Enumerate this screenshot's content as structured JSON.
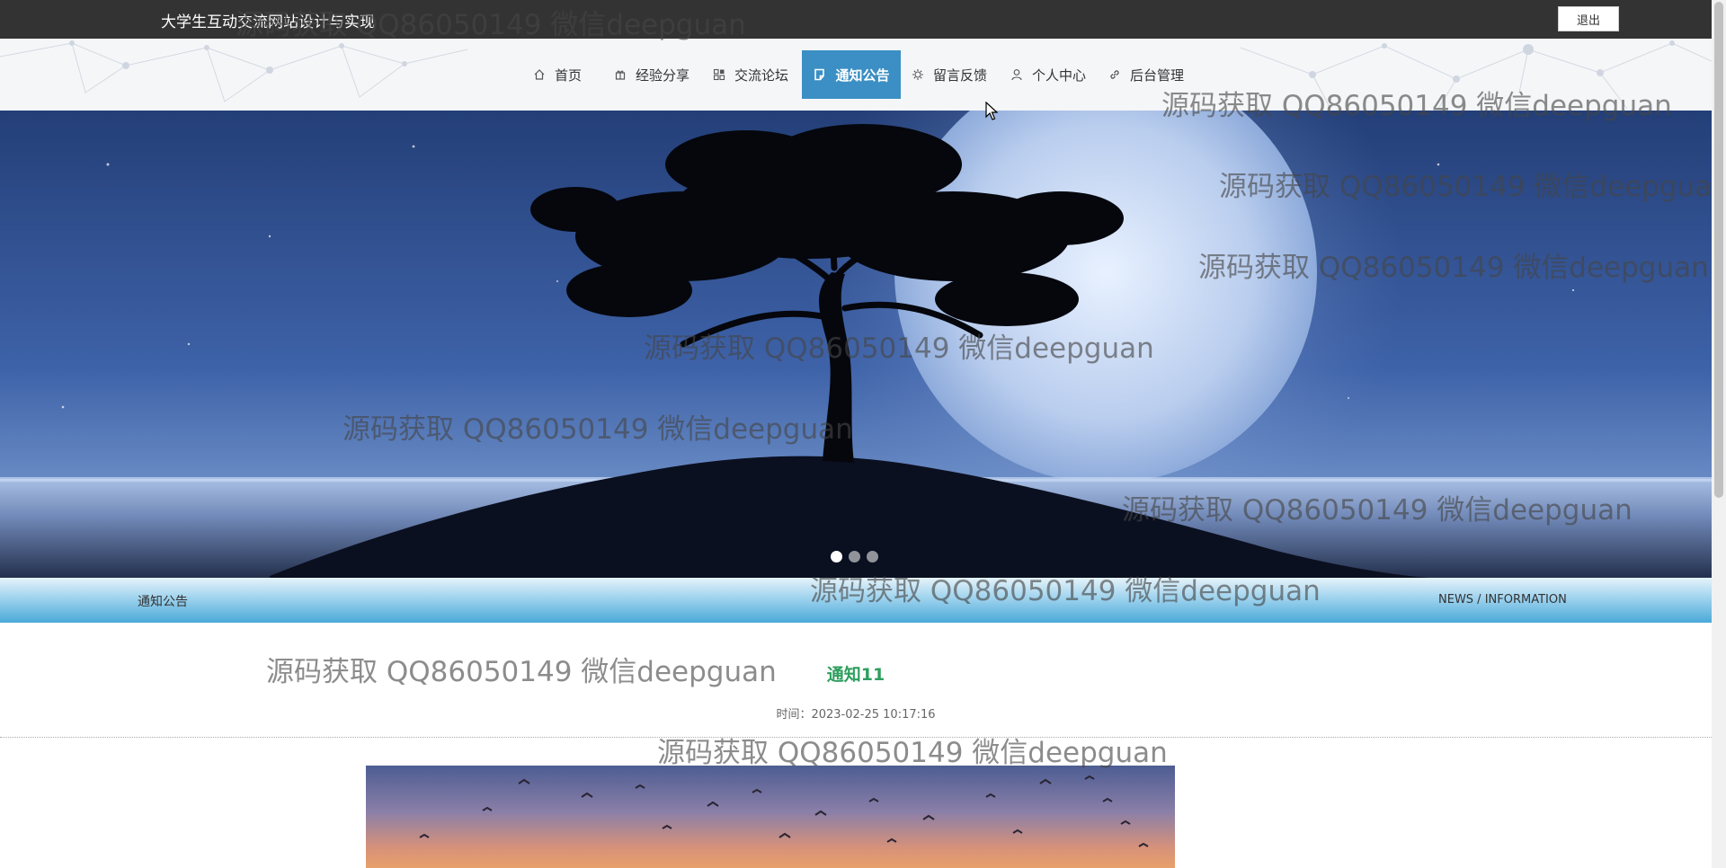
{
  "header": {
    "site_title": "大学生互动交流网站设计与实现",
    "logout_label": "退出"
  },
  "nav": {
    "items": [
      {
        "label": "首页",
        "icon": "home-icon"
      },
      {
        "label": "经验分享",
        "icon": "gift-icon"
      },
      {
        "label": "交流论坛",
        "icon": "grid-icon"
      },
      {
        "label": "通知公告",
        "icon": "note-icon",
        "active": true
      },
      {
        "label": "留言反馈",
        "icon": "gear-icon"
      },
      {
        "label": "个人中心",
        "icon": "user-icon"
      },
      {
        "label": "后台管理",
        "icon": "link-icon"
      }
    ],
    "active_color": "#3b8fc4"
  },
  "banner": {
    "slide_count": 3,
    "active_slide": 1
  },
  "section": {
    "title": "通知公告",
    "subtitle_en": "NEWS / INFORMATION"
  },
  "article": {
    "title": "通知11",
    "time_label": "时间：",
    "time_value": "2023-02-25 10:17:16",
    "title_color": "#2e9e5e"
  },
  "watermark": {
    "text": "源码获取 QQ86050149 微信deepguan"
  }
}
